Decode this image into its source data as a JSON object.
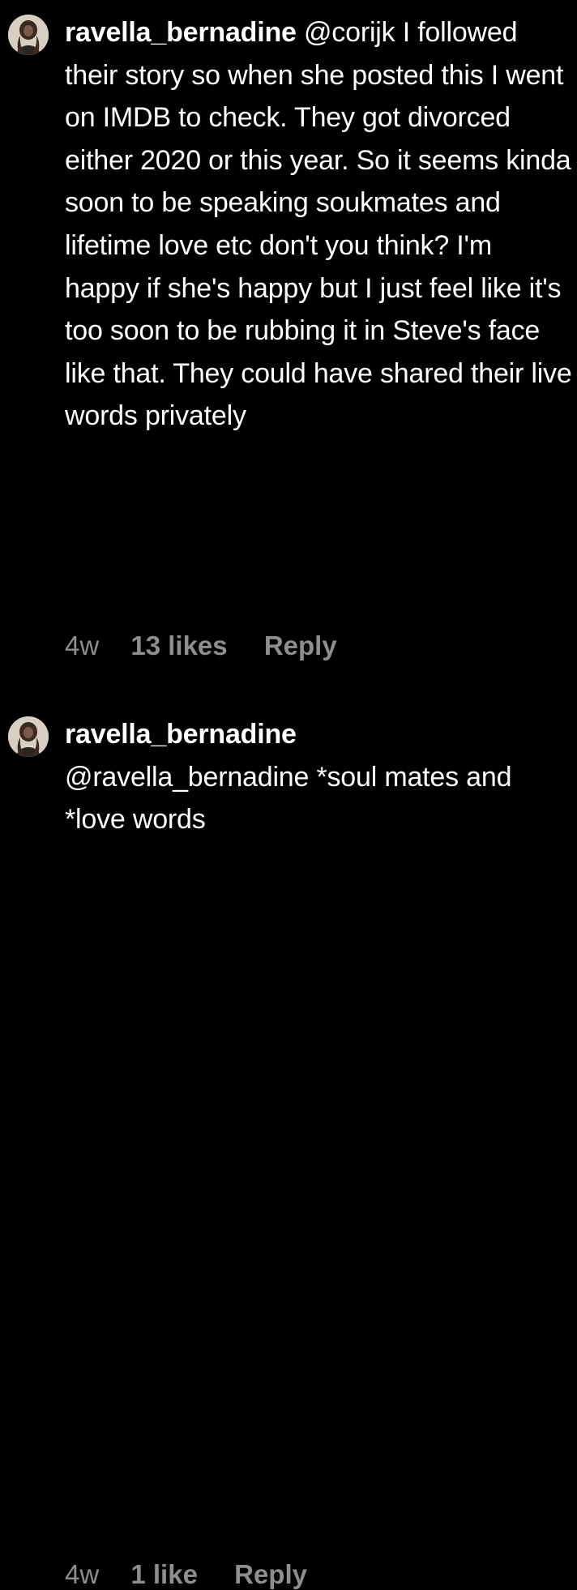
{
  "comments": [
    {
      "username": "ravella_bernadine",
      "text": " @corijk I followed their story so when she posted this I went on IMDB to check. They got divorced either 2020 or this year. So it seems kinda soon to be speaking soukmates and lifetime love etc don't you think? I'm happy if she's happy but I just feel like it's too soon to be rubbing it in Steve's face like that. They could have shared their live words privately",
      "time": "4w",
      "likes": "13 likes",
      "reply": "Reply"
    },
    {
      "username": "ravella_bernadine",
      "text": "@ravella_bernadine *soul mates and *love words",
      "time": "4w",
      "likes": "1 like",
      "reply": "Reply"
    }
  ],
  "colors": {
    "background": "#000000",
    "text": "#ffffff",
    "meta": "#8e8e8e"
  },
  "icons": {
    "avatar": "profile-photo-avatar"
  }
}
